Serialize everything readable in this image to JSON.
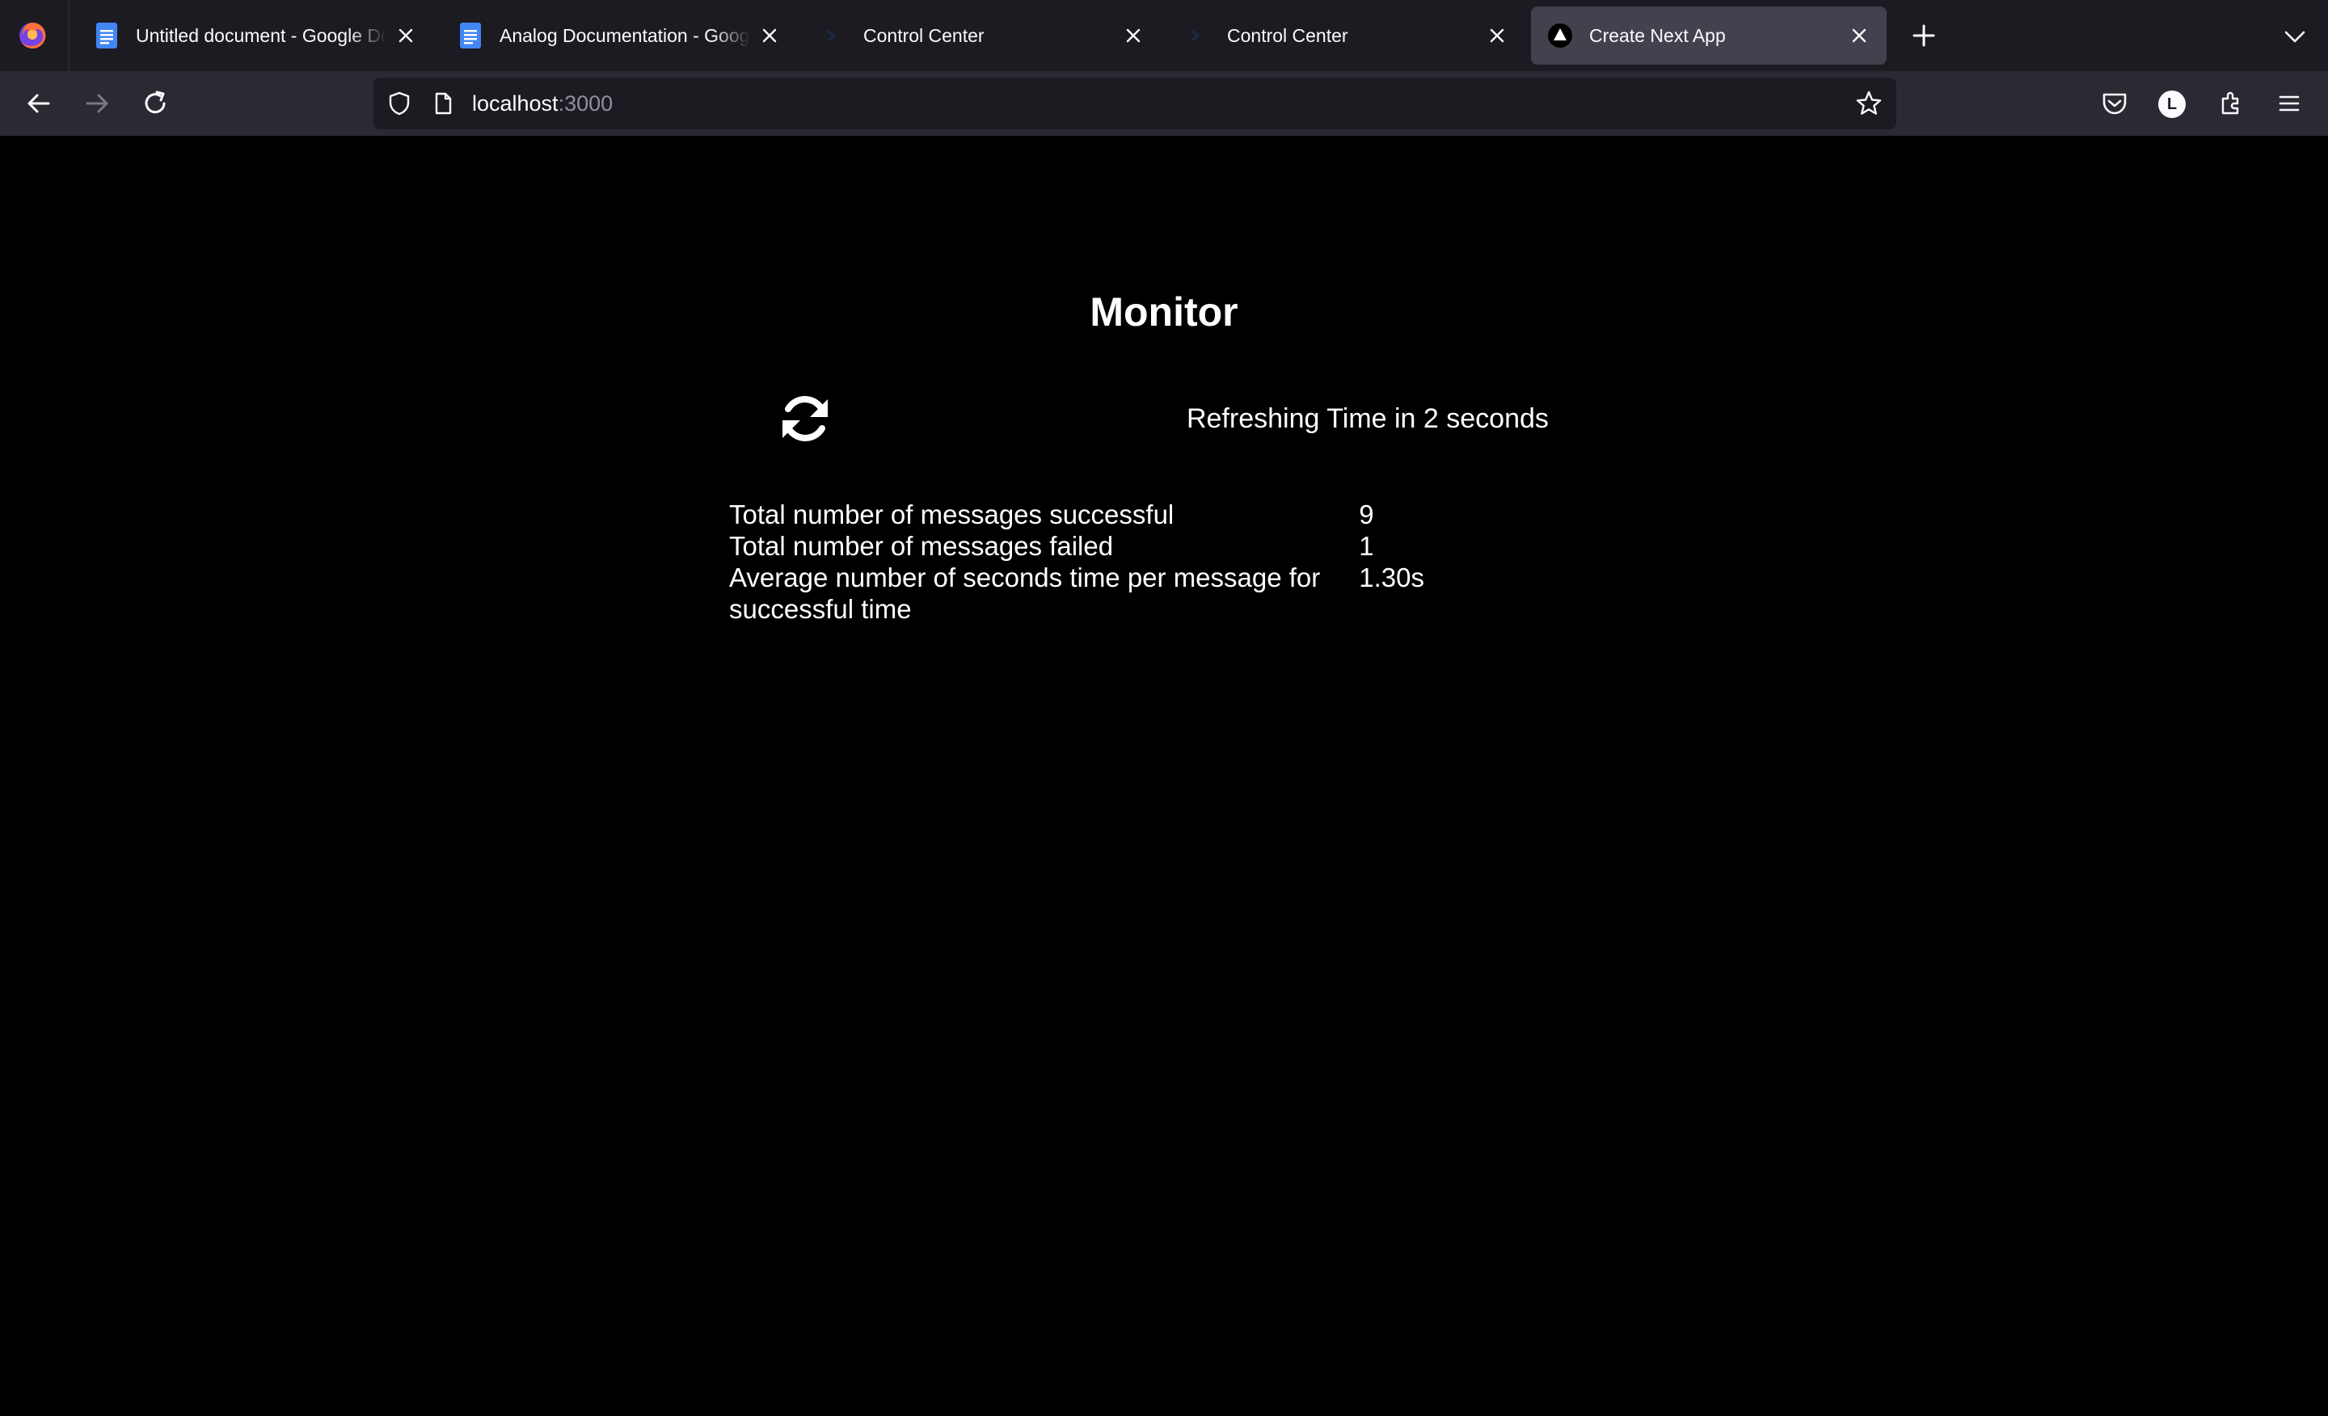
{
  "browser": {
    "tabs": [
      {
        "title": "Untitled document - Google Docs",
        "favicon": "google-docs-icon",
        "active": false
      },
      {
        "title": "Analog Documentation - Google Docs",
        "favicon": "google-docs-icon",
        "active": false
      },
      {
        "title": "Control Center",
        "favicon": "control-center-icon",
        "active": false
      },
      {
        "title": "Control Center",
        "favicon": "control-center-icon",
        "active": false
      },
      {
        "title": "Create Next App",
        "favicon": "nextjs-icon",
        "active": true
      }
    ],
    "url": {
      "host": "localhost",
      "port": ":3000"
    },
    "account_initial": "L"
  },
  "page": {
    "heading": "Monitor",
    "refresh_text": "Refreshing Time in 2 seconds",
    "stats": [
      {
        "label": "Total number of messages successful",
        "value": "9"
      },
      {
        "label": "Total number of messages failed",
        "value": "1"
      },
      {
        "label": "Average number of seconds time per message for successful time",
        "value": "1.30s"
      }
    ]
  },
  "colors": {
    "tabstrip_bg": "#1c1b22",
    "navbar_bg": "#2b2a33",
    "active_tab_bg": "#42414d",
    "page_bg": "#000000",
    "text": "#ffffff",
    "docs_blue": "#4285f4"
  }
}
